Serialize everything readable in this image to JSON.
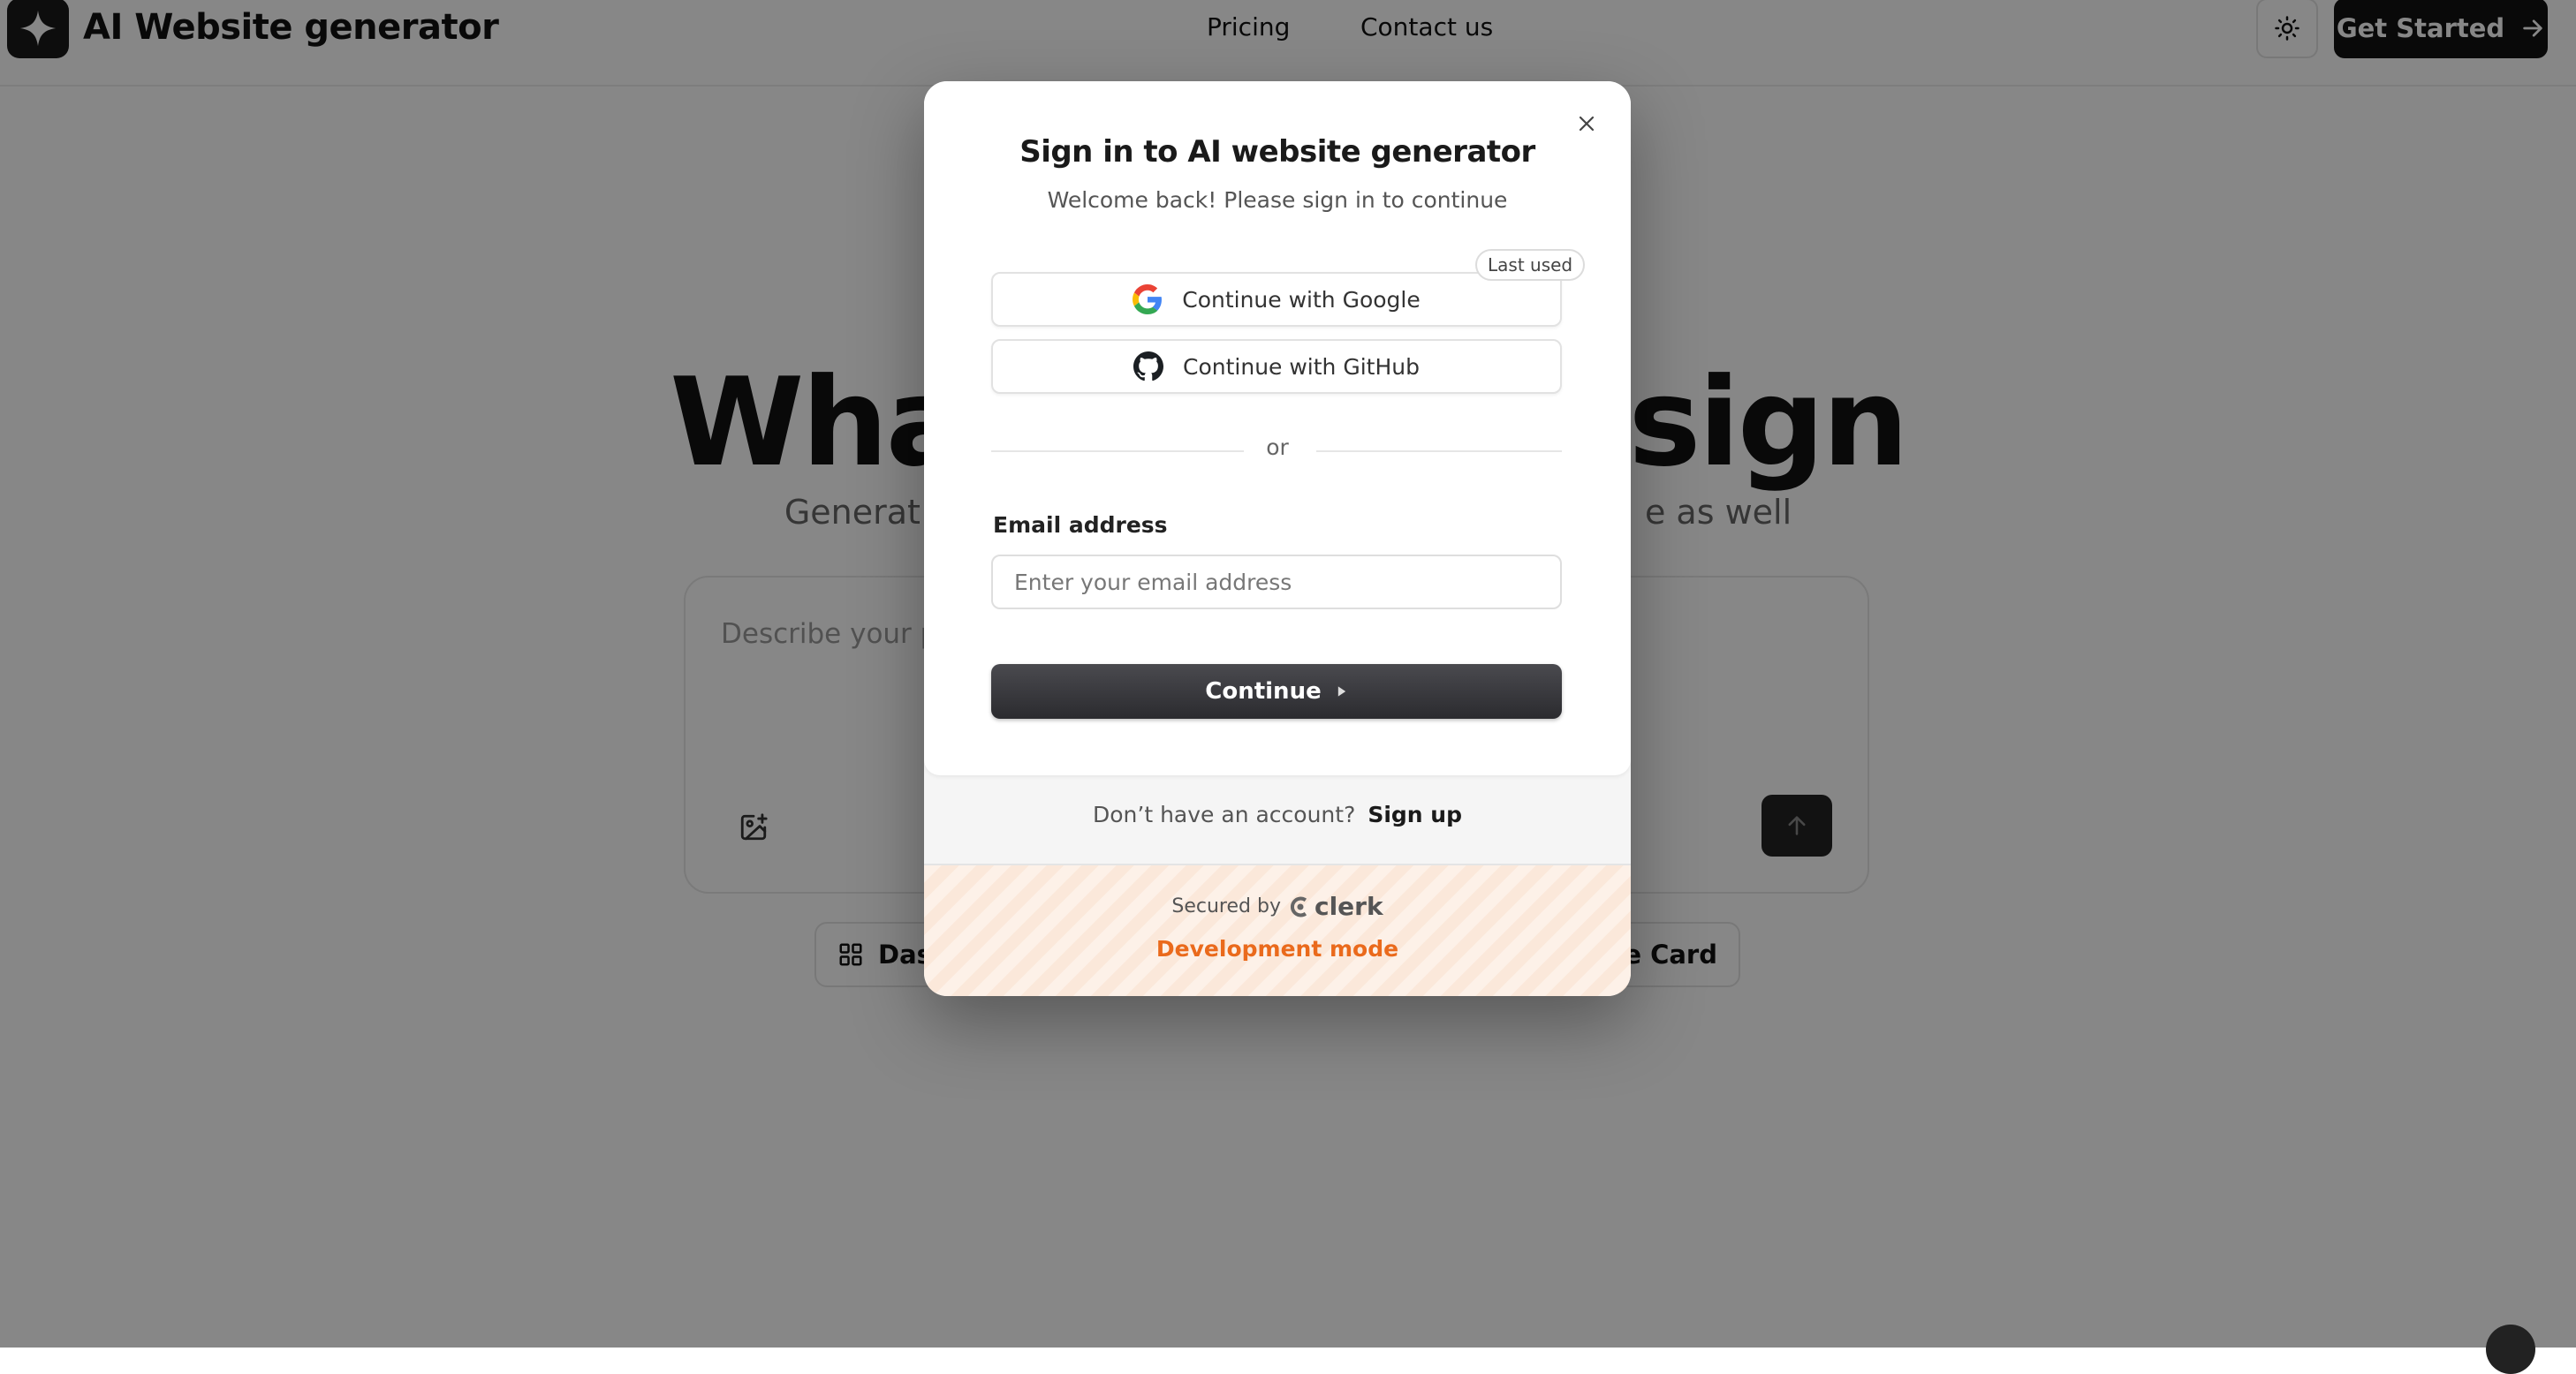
{
  "header": {
    "app_title": "AI Website generator",
    "nav": [
      {
        "label": "Pricing"
      },
      {
        "label": "Contact us"
      }
    ],
    "cta_label": "Get Started"
  },
  "hero": {
    "title_left": "Wha",
    "title_right": "esign",
    "subtitle_left": "Generat",
    "subtitle_right": "e as well"
  },
  "prompt": {
    "placeholder": "Describe your p"
  },
  "chips": [
    {
      "label": "Das"
    },
    {
      "label": "ile Card"
    }
  ],
  "modal": {
    "title": "Sign in to AI website generator",
    "subtitle": "Welcome back! Please sign in to continue",
    "google_label": "Continue with Google",
    "github_label": "Continue with GitHub",
    "last_used_badge": "Last used",
    "divider_text": "or",
    "email_label": "Email address",
    "email_placeholder": "Enter your email address",
    "email_value": "",
    "continue_label": "Continue",
    "no_account_text": "Don’t have an account?",
    "sign_up_label": "Sign up",
    "secured_by": "Secured by",
    "clerk_brand": "clerk",
    "dev_mode": "Development mode"
  },
  "colors": {
    "dev_mode": "#ea6a1c",
    "primary_button": "#2b2b2f",
    "overlay": "rgba(0,0,0,0.47)"
  },
  "icons": [
    "sparkle-logo-icon",
    "sun-icon",
    "arrow-right-icon",
    "image-add-icon",
    "arrow-up-icon",
    "grid-icon",
    "close-icon",
    "google-icon",
    "github-icon",
    "caret-right-icon",
    "clerk-logo-icon"
  ]
}
